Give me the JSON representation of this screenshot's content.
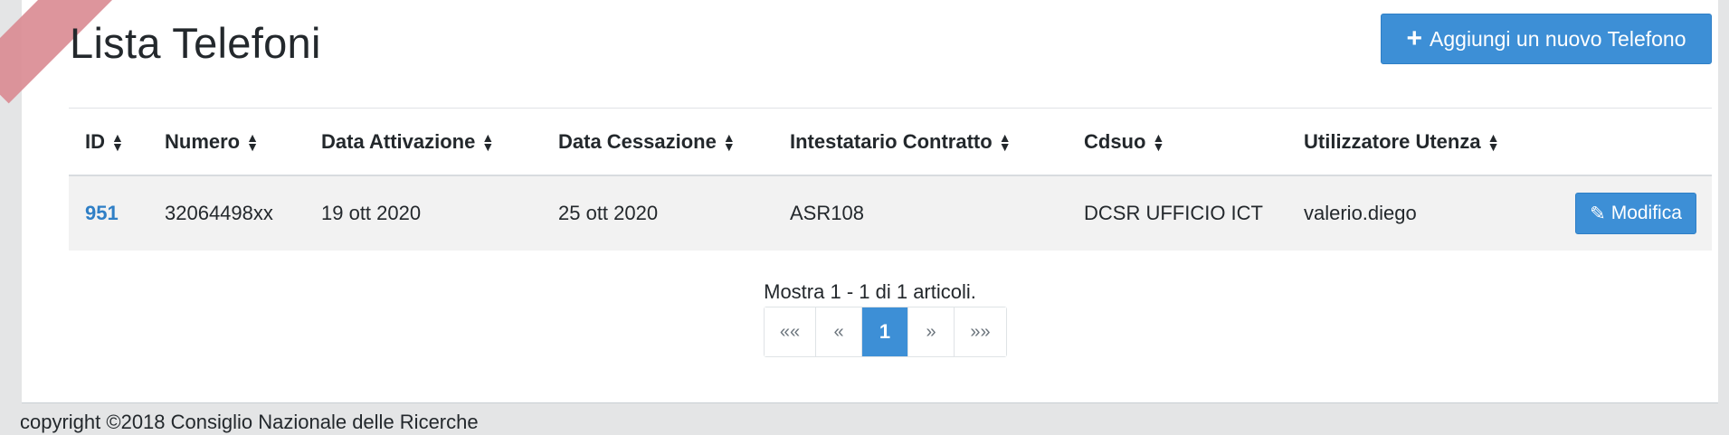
{
  "page": {
    "title": "Lista Telefoni",
    "add_button_label": "Aggiungi un nuovo Telefono"
  },
  "table": {
    "columns": [
      "ID",
      "Numero",
      "Data Attivazione",
      "Data Cessazione",
      "Intestatario Contratto",
      "Cdsuo",
      "Utilizzatore Utenza"
    ],
    "rows": [
      {
        "id": "951",
        "numero": "32064498xx",
        "data_attivazione": "19 ott 2020",
        "data_cessazione": "25 ott 2020",
        "intestatario": "ASR108",
        "cdsuo": "DCSR UFFICIO ICT",
        "utilizzatore": "valerio.diego",
        "action_label": "Modifica"
      }
    ]
  },
  "summary": "Mostra 1 - 1 di 1 articoli.",
  "pagination": {
    "first": "««",
    "prev": "«",
    "current": "1",
    "next": "»",
    "last": "»»"
  },
  "footer": "copyright ©2018 Consiglio Nazionale delle Ricerche",
  "colors": {
    "primary": "#3d8fd6",
    "link": "#2f7fc6",
    "ribbon": "#d98a91"
  },
  "icons": {
    "add": "plus-icon",
    "edit": "pencil-icon",
    "sort": "sort-icon"
  }
}
